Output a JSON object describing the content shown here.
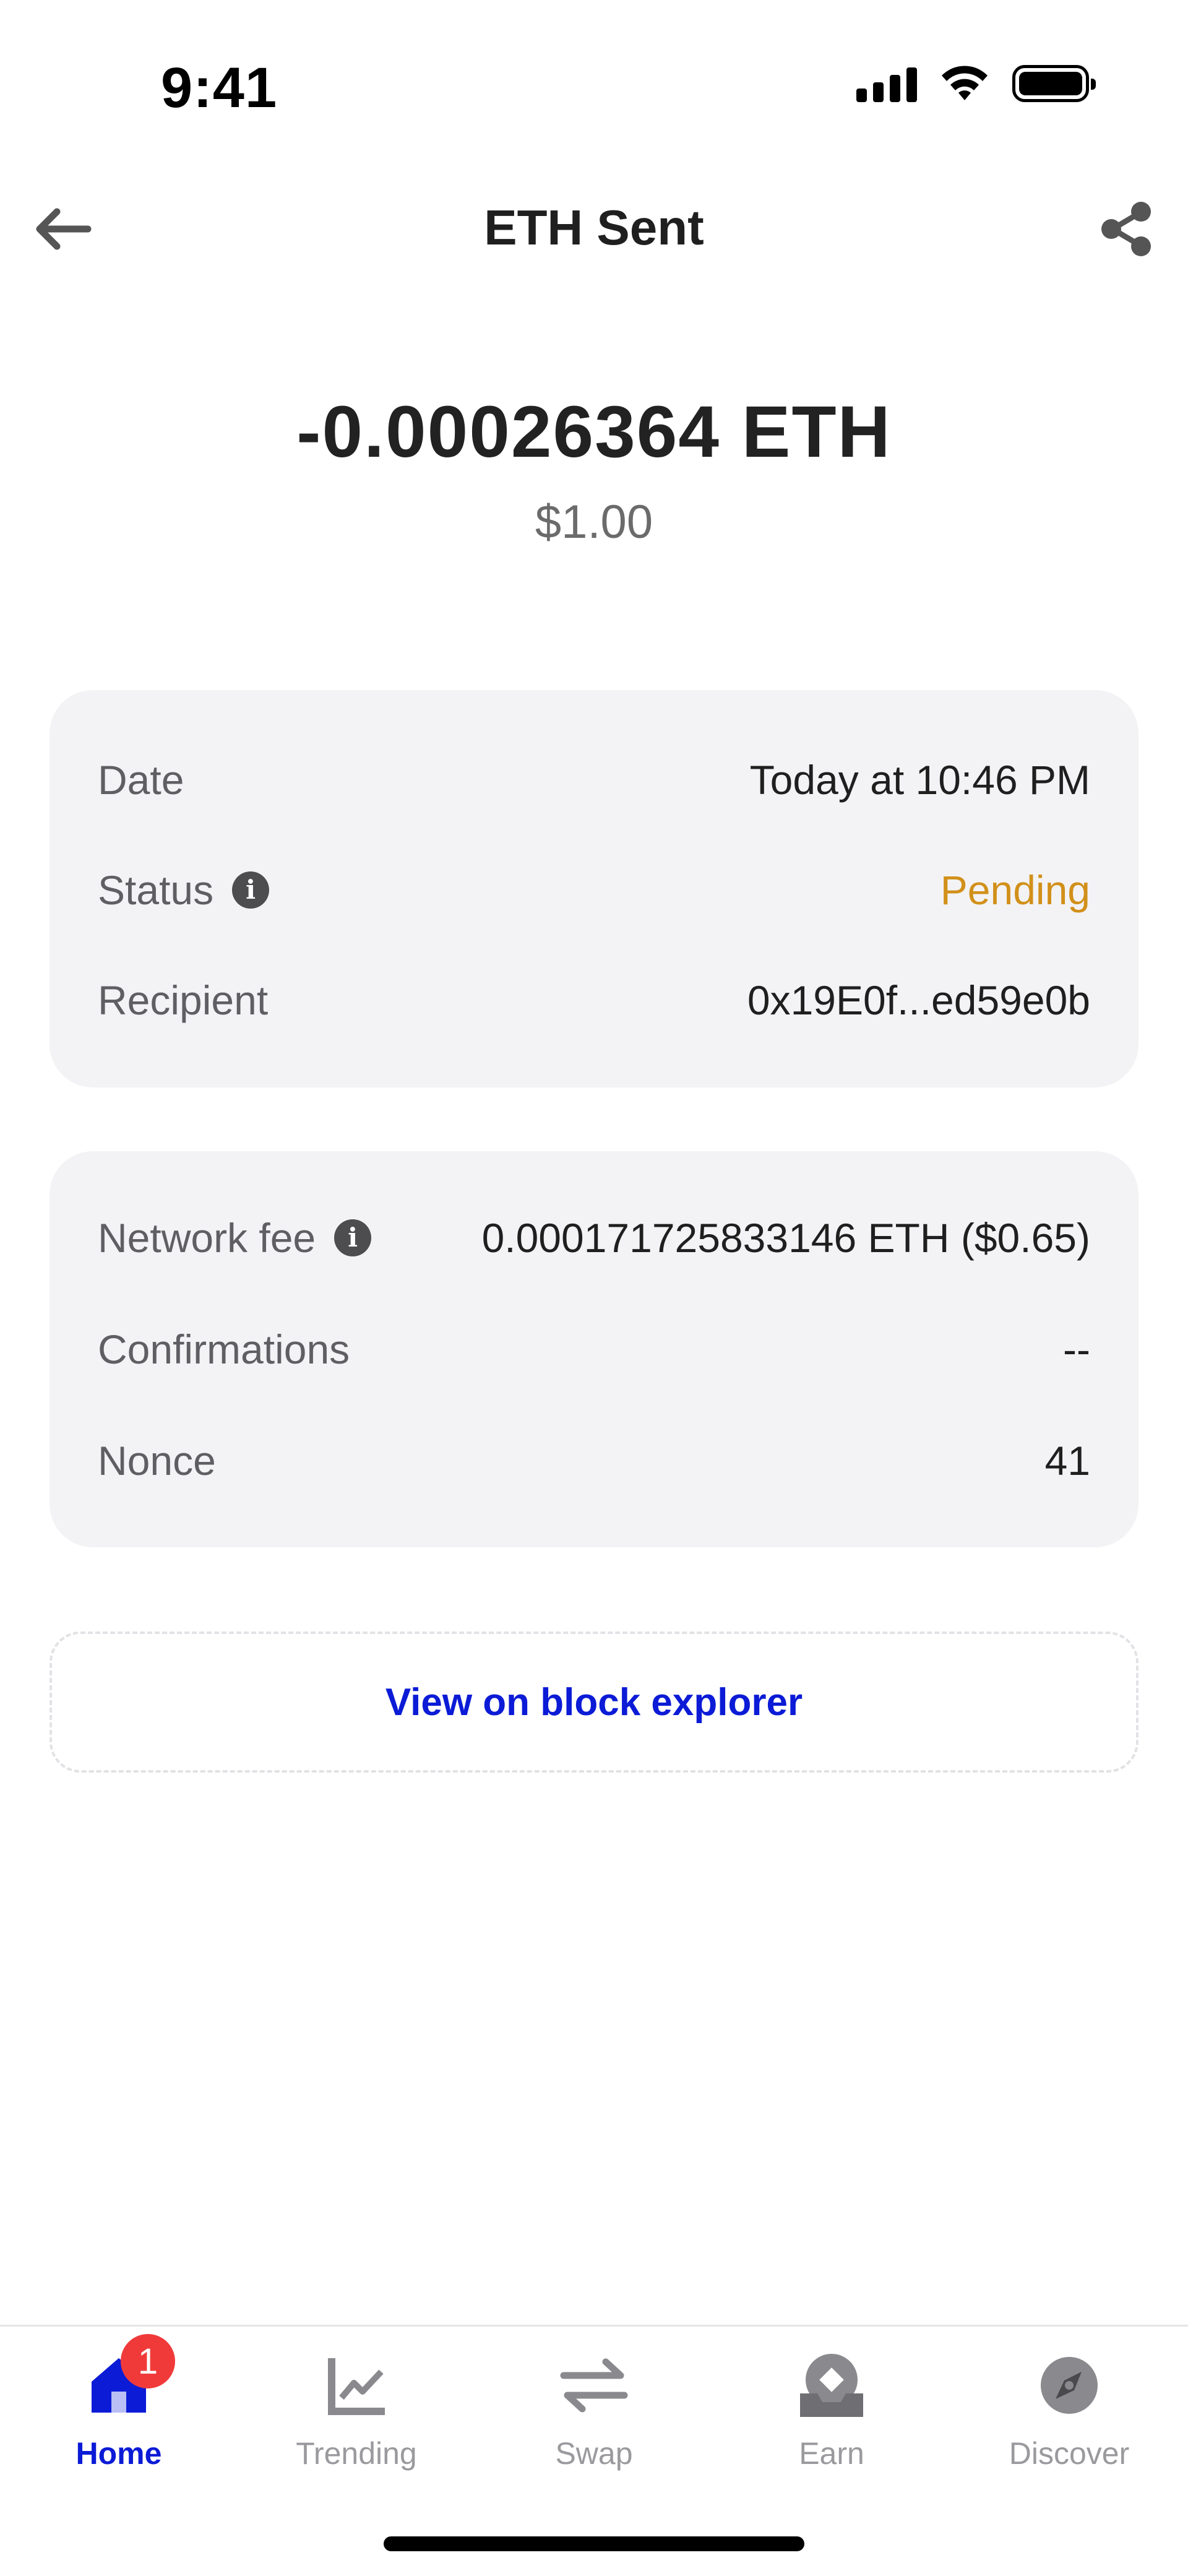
{
  "status_bar": {
    "time": "9:41"
  },
  "header": {
    "title": "ETH Sent",
    "back_icon": "arrow-left-icon",
    "share_icon": "share-icon"
  },
  "transaction": {
    "amount": "-0.00026364 ETH",
    "fiat_value": "$1.00"
  },
  "details_card": {
    "rows": [
      {
        "label": "Date",
        "value": "Today at 10:46 PM"
      },
      {
        "label": "Status",
        "value": "Pending",
        "has_info": true
      },
      {
        "label": "Recipient",
        "value": "0x19E0f...ed59e0b"
      }
    ]
  },
  "fee_card": {
    "rows": [
      {
        "label": "Network fee",
        "value": "0.000171725833146 ETH ($0.65)",
        "has_info": true
      },
      {
        "label": "Confirmations",
        "value": "--"
      },
      {
        "label": "Nonce",
        "value": "41"
      }
    ]
  },
  "explorer_button": {
    "label": "View on block explorer"
  },
  "tab_bar": {
    "tabs": [
      {
        "label": "Home",
        "icon": "home-icon",
        "badge": "1",
        "active": true
      },
      {
        "label": "Trending",
        "icon": "trending-chart-icon"
      },
      {
        "label": "Swap",
        "icon": "swap-arrows-icon"
      },
      {
        "label": "Earn",
        "icon": "earn-icon"
      },
      {
        "label": "Discover",
        "icon": "compass-icon"
      }
    ]
  },
  "colors": {
    "accent": "#0b1bd6",
    "pending": "#d2901a",
    "card_bg": "#f3f3f5",
    "badge": "#f03a3a"
  }
}
